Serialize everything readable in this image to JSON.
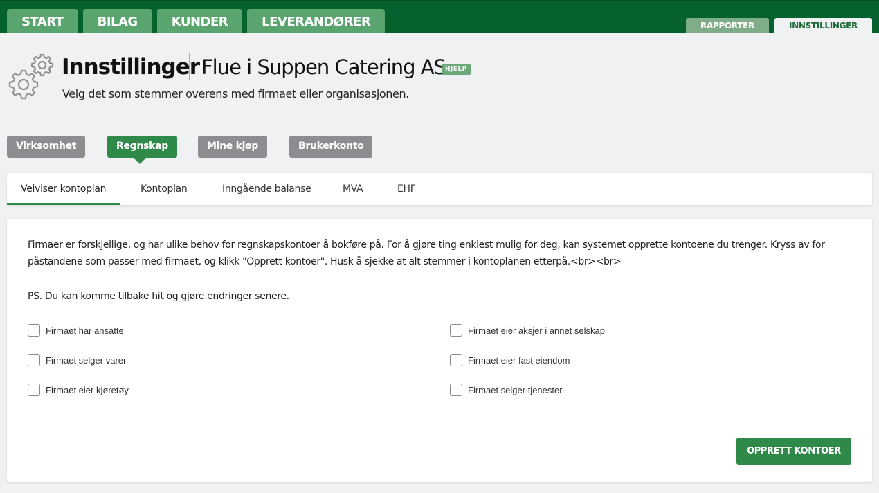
{
  "top_nav": {
    "main_tabs": [
      "START",
      "BILAG",
      "KUNDER",
      "LEVERANDØRER"
    ],
    "right_tabs": [
      {
        "label": "RAPPORTER",
        "active": false
      },
      {
        "label": "INNSTILLINGER",
        "active": true
      }
    ]
  },
  "header": {
    "title": "Innstillinger",
    "company": "Flue i Suppen Catering AS",
    "help_label": "HJELP",
    "subtitle": "Velg det som stemmer overens med firmaet eller organisasjonen.",
    "icon": "gears-icon"
  },
  "sections": [
    {
      "label": "Virksomhet",
      "active": false
    },
    {
      "label": "Regnskap",
      "active": true
    },
    {
      "label": "Mine kjøp",
      "active": false
    },
    {
      "label": "Brukerkonto",
      "active": false
    }
  ],
  "subtabs": [
    {
      "label": "Veiviser kontoplan",
      "active": true
    },
    {
      "label": "Kontoplan",
      "active": false
    },
    {
      "label": "Inngående balanse",
      "active": false
    },
    {
      "label": "MVA",
      "active": false
    },
    {
      "label": "EHF",
      "active": false
    }
  ],
  "wizard": {
    "intro": "Firmaer er forskjellige, og har ulike behov for regnskapskontoer å bokføre på. For å gjøre ting enklest mulig for deg, kan systemet opprette kontoene du trenger. Kryss av for påstandene som passer med firmaet, og klikk \"Opprett kontoer\". Husk å sjekke at alt stemmer i kontoplanen etterpå.<br><br>",
    "ps": "PS. Du kan komme tilbake hit og gjøre endringer senere.",
    "options": [
      {
        "label": "Firmaet har ansatte",
        "checked": false
      },
      {
        "label": "Firmaet selger varer",
        "checked": false
      },
      {
        "label": "Firmaet eier kjøretøy",
        "checked": false
      },
      {
        "label": "Firmaet eier aksjer i annet selskap",
        "checked": false
      },
      {
        "label": "Firmaet eier fast eiendom",
        "checked": false
      },
      {
        "label": "Firmaet selger tjenester",
        "checked": false
      }
    ],
    "create_button": "OPPRETT KONTOER"
  },
  "colors": {
    "nav_bg": "#05622e",
    "accent_green": "#2f8a4a",
    "inactive_pill": "#8b8d90"
  }
}
